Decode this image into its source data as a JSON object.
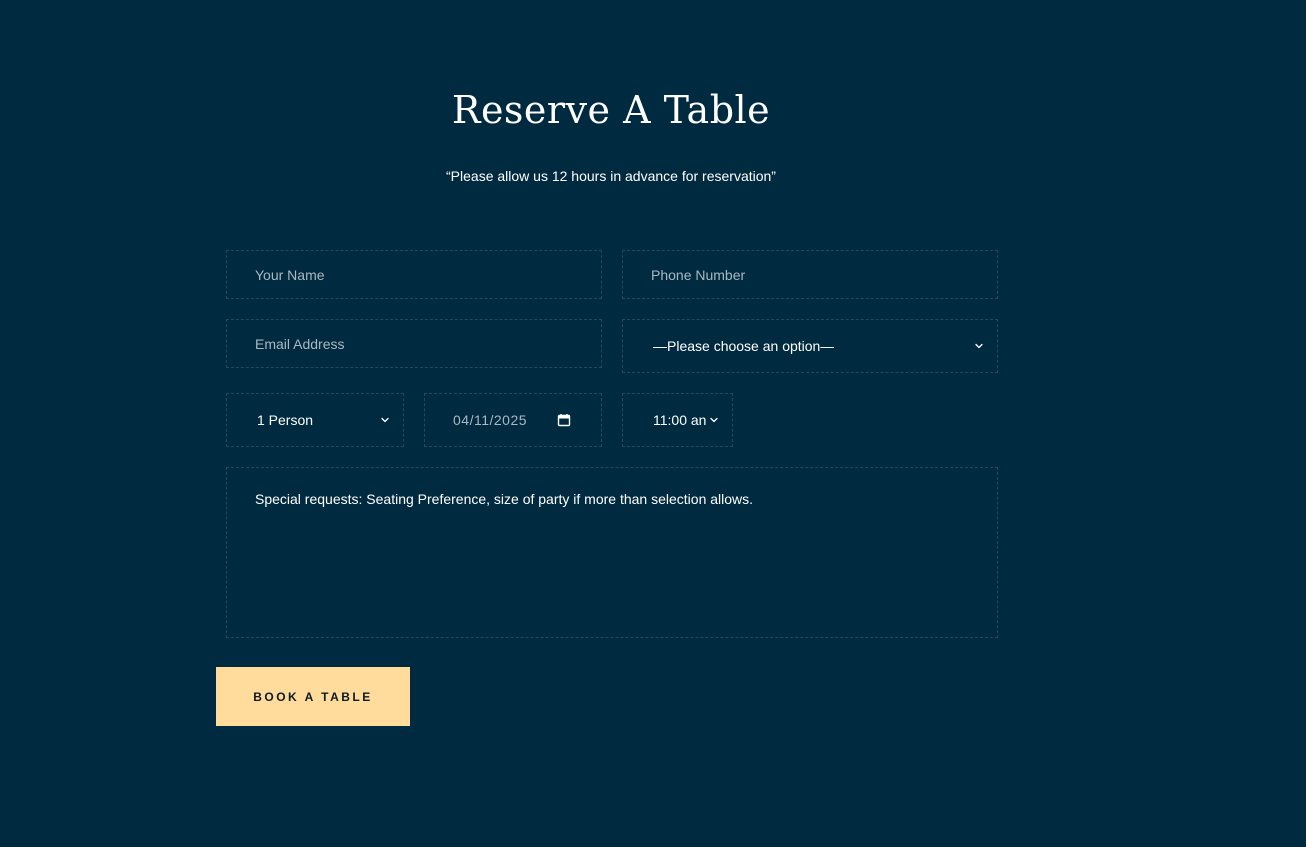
{
  "header": {
    "title": "Reserve A Table",
    "subtitle": "“Please allow us 12 hours in advance for reservation”"
  },
  "form": {
    "name_placeholder": "Your Name",
    "phone_placeholder": "Phone Number",
    "email_placeholder": "Email Address",
    "option_select_value": "—Please choose an option—",
    "party_size_value": "1 Person",
    "date_value": "04/11/2025",
    "time_value": "11:00 an",
    "requests_placeholder": "Special requests: Seating Preference, size of party if more than selection allows.",
    "submit_label": "BOOK A TABLE"
  },
  "colors": {
    "background": "#002a3f",
    "field_border": "#1d4b60",
    "button": "#ffdb9c",
    "button_text": "#0e1a22",
    "placeholder": "#a9b8c2"
  },
  "icons": {
    "dropdown": "chevron-down-icon",
    "date_picker": "calendar-icon"
  }
}
